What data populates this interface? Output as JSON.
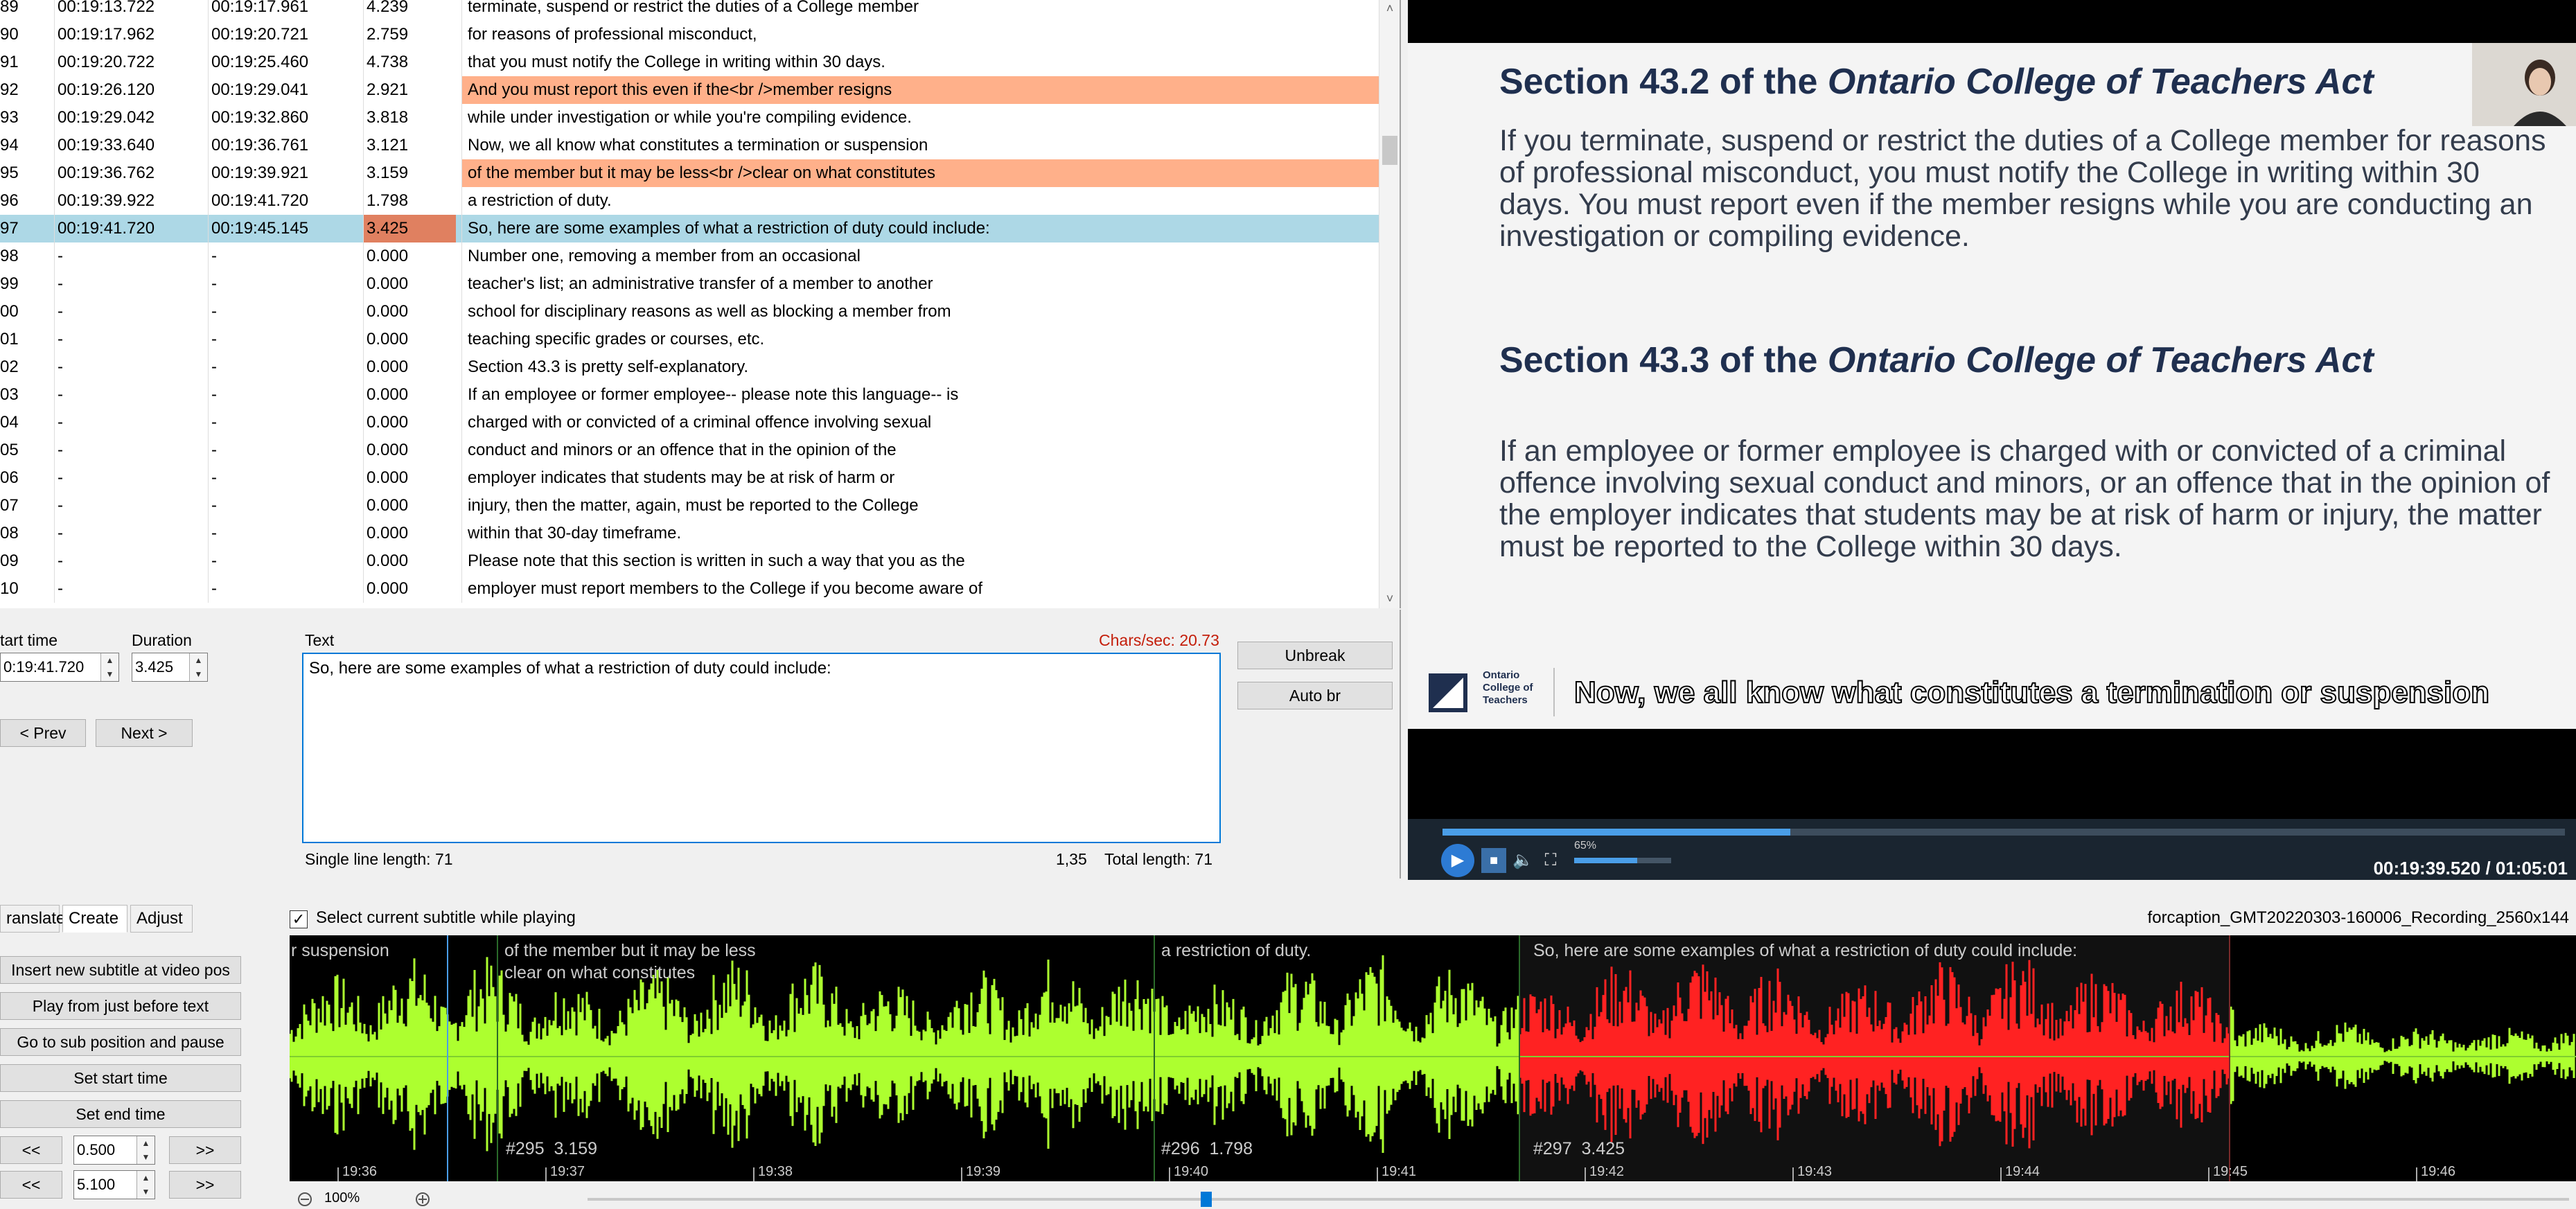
{
  "grid": {
    "rows": [
      {
        "n": "89",
        "start": "00:19:13.722",
        "end": "00:19:17.961",
        "dur": "4.239",
        "text": "terminate, suspend or restrict the duties of a College member",
        "hl": false,
        "sel": false
      },
      {
        "n": "90",
        "start": "00:19:17.962",
        "end": "00:19:20.721",
        "dur": "2.759",
        "text": "for reasons of professional misconduct,",
        "hl": false,
        "sel": false
      },
      {
        "n": "91",
        "start": "00:19:20.722",
        "end": "00:19:25.460",
        "dur": "4.738",
        "text": "that you must notify the College in writing within 30 days.",
        "hl": false,
        "sel": false
      },
      {
        "n": "92",
        "start": "00:19:26.120",
        "end": "00:19:29.041",
        "dur": "2.921",
        "text": "And you must report this even if the<br />member resigns",
        "hl": true,
        "sel": false
      },
      {
        "n": "93",
        "start": "00:19:29.042",
        "end": "00:19:32.860",
        "dur": "3.818",
        "text": "while under investigation or while you're compiling evidence.",
        "hl": false,
        "sel": false
      },
      {
        "n": "94",
        "start": "00:19:33.640",
        "end": "00:19:36.761",
        "dur": "3.121",
        "text": "Now, we all know what constitutes a termination or suspension",
        "hl": false,
        "sel": false
      },
      {
        "n": "95",
        "start": "00:19:36.762",
        "end": "00:19:39.921",
        "dur": "3.159",
        "text": "of the member but it may be less<br />clear on what constitutes",
        "hl": true,
        "sel": false
      },
      {
        "n": "96",
        "start": "00:19:39.922",
        "end": "00:19:41.720",
        "dur": "1.798",
        "text": "a restriction of duty.",
        "hl": false,
        "sel": false
      },
      {
        "n": "97",
        "start": "00:19:41.720",
        "end": "00:19:45.145",
        "dur": "3.425",
        "text": "So, here are some examples of what a restriction of duty could include:",
        "hl": false,
        "sel": true
      },
      {
        "n": "98",
        "start": "-",
        "end": "-",
        "dur": "0.000",
        "text": "Number one, removing a member from an occasional",
        "hl": false,
        "sel": false
      },
      {
        "n": "99",
        "start": "-",
        "end": "-",
        "dur": "0.000",
        "text": "teacher's list; an administrative transfer of a member to another",
        "hl": false,
        "sel": false
      },
      {
        "n": "00",
        "start": "-",
        "end": "-",
        "dur": "0.000",
        "text": "school for disciplinary reasons as well as blocking a member from",
        "hl": false,
        "sel": false
      },
      {
        "n": "01",
        "start": "-",
        "end": "-",
        "dur": "0.000",
        "text": "teaching specific grades or courses, etc.",
        "hl": false,
        "sel": false
      },
      {
        "n": "02",
        "start": "-",
        "end": "-",
        "dur": "0.000",
        "text": "Section 43.3 is pretty self-explanatory.",
        "hl": false,
        "sel": false
      },
      {
        "n": "03",
        "start": "-",
        "end": "-",
        "dur": "0.000",
        "text": "If an employee or former employee-- please note this language-- is",
        "hl": false,
        "sel": false
      },
      {
        "n": "04",
        "start": "-",
        "end": "-",
        "dur": "0.000",
        "text": "charged with or convicted of a criminal offence involving sexual",
        "hl": false,
        "sel": false
      },
      {
        "n": "05",
        "start": "-",
        "end": "-",
        "dur": "0.000",
        "text": "conduct and minors or an offence that in the opinion of the",
        "hl": false,
        "sel": false
      },
      {
        "n": "06",
        "start": "-",
        "end": "-",
        "dur": "0.000",
        "text": "employer indicates that students may be at risk of harm or",
        "hl": false,
        "sel": false
      },
      {
        "n": "07",
        "start": "-",
        "end": "-",
        "dur": "0.000",
        "text": "injury, then the matter, again, must be reported to the College",
        "hl": false,
        "sel": false
      },
      {
        "n": "08",
        "start": "-",
        "end": "-",
        "dur": "0.000",
        "text": "within that 30-day timeframe.",
        "hl": false,
        "sel": false
      },
      {
        "n": "09",
        "start": "-",
        "end": "-",
        "dur": "0.000",
        "text": "Please note that this section is written in such a way that you as the",
        "hl": false,
        "sel": false
      },
      {
        "n": "10",
        "start": "-",
        "end": "-",
        "dur": "0.000",
        "text": "employer must report members to the College if you become aware of",
        "hl": false,
        "sel": false
      }
    ]
  },
  "edit": {
    "start_label": "tart time",
    "duration_label": "Duration",
    "text_label": "Text",
    "charsec": "Chars/sec: 20.73",
    "start_value": "0:19:41.720",
    "duration_value": "3.425",
    "text_value": "So, here are some examples of what a restriction of duty could include:",
    "prev": "< Prev",
    "next": "Next >",
    "unbreak": "Unbreak",
    "autobr": "Auto br",
    "single_line": "Single line length: 71",
    "cursor_pos": "1,35",
    "total_len": "Total length: 71"
  },
  "slide": {
    "h1_prefix": "Section 43.2 of the ",
    "h1_italic": "Ontario College of Teachers Act",
    "p1": "If you terminate, suspend or restrict the duties of a College member for reasons of professional misconduct, you must notify the College in writing within 30 days. You must report even if the member resigns while you are conducting an investigation or compiling evidence.",
    "h2_prefix": "Section 43.3 of the ",
    "h2_italic": "Ontario College of Teachers Act",
    "p2": "If an employee or former employee is charged with or convicted of a criminal offence involving sexual conduct and minors, or an offence that in the opinion of the employer indicates that students may be at risk of harm or injury, the matter must be reported to the College within 30 days.",
    "logo_text": "Ontario College of Teachers",
    "burned_subtitle": "Now, we all know what constitutes a termination or suspension"
  },
  "player": {
    "volume": "65%",
    "volume_fraction": 0.65,
    "progress_fraction": 0.31,
    "timecode": "00:19:39.520 / 01:05:01"
  },
  "toolbar": {
    "tab_translate": "ranslate",
    "tab_create": "Create",
    "tab_adjust": "Adjust",
    "select_while_playing": "Select current subtitle while playing",
    "filename": "forcaption_GMT20220303-160006_Recording_2560x144"
  },
  "create": {
    "insert": "Insert new subtitle at video pos",
    "play_before": "Play from just before text",
    "goto_pause": "Go to sub position and pause",
    "set_start": "Set start time",
    "set_end": "Set end time",
    "back": "<<",
    "fwd": ">>",
    "step1": "0.500",
    "step2": "5.100"
  },
  "waveform": {
    "labels": [
      {
        "text": "r suspension"
      },
      {
        "text": "of the member but it may be less\nclear on what constitutes"
      },
      {
        "text": "a restriction of duty."
      },
      {
        "text": "So, here are some examples of what a restriction of duty could include:"
      }
    ],
    "nums": [
      "#295  3.159",
      "#296  1.798",
      "#297  3.425"
    ],
    "ticks": [
      "19:36",
      "19:37",
      "19:38",
      "19:39",
      "19:40",
      "19:41",
      "19:42",
      "19:43",
      "19:44",
      "19:45",
      "19:46"
    ],
    "zoom": "100%",
    "colors": {
      "normal": "#adff2f",
      "selected": "#ff2222"
    }
  }
}
